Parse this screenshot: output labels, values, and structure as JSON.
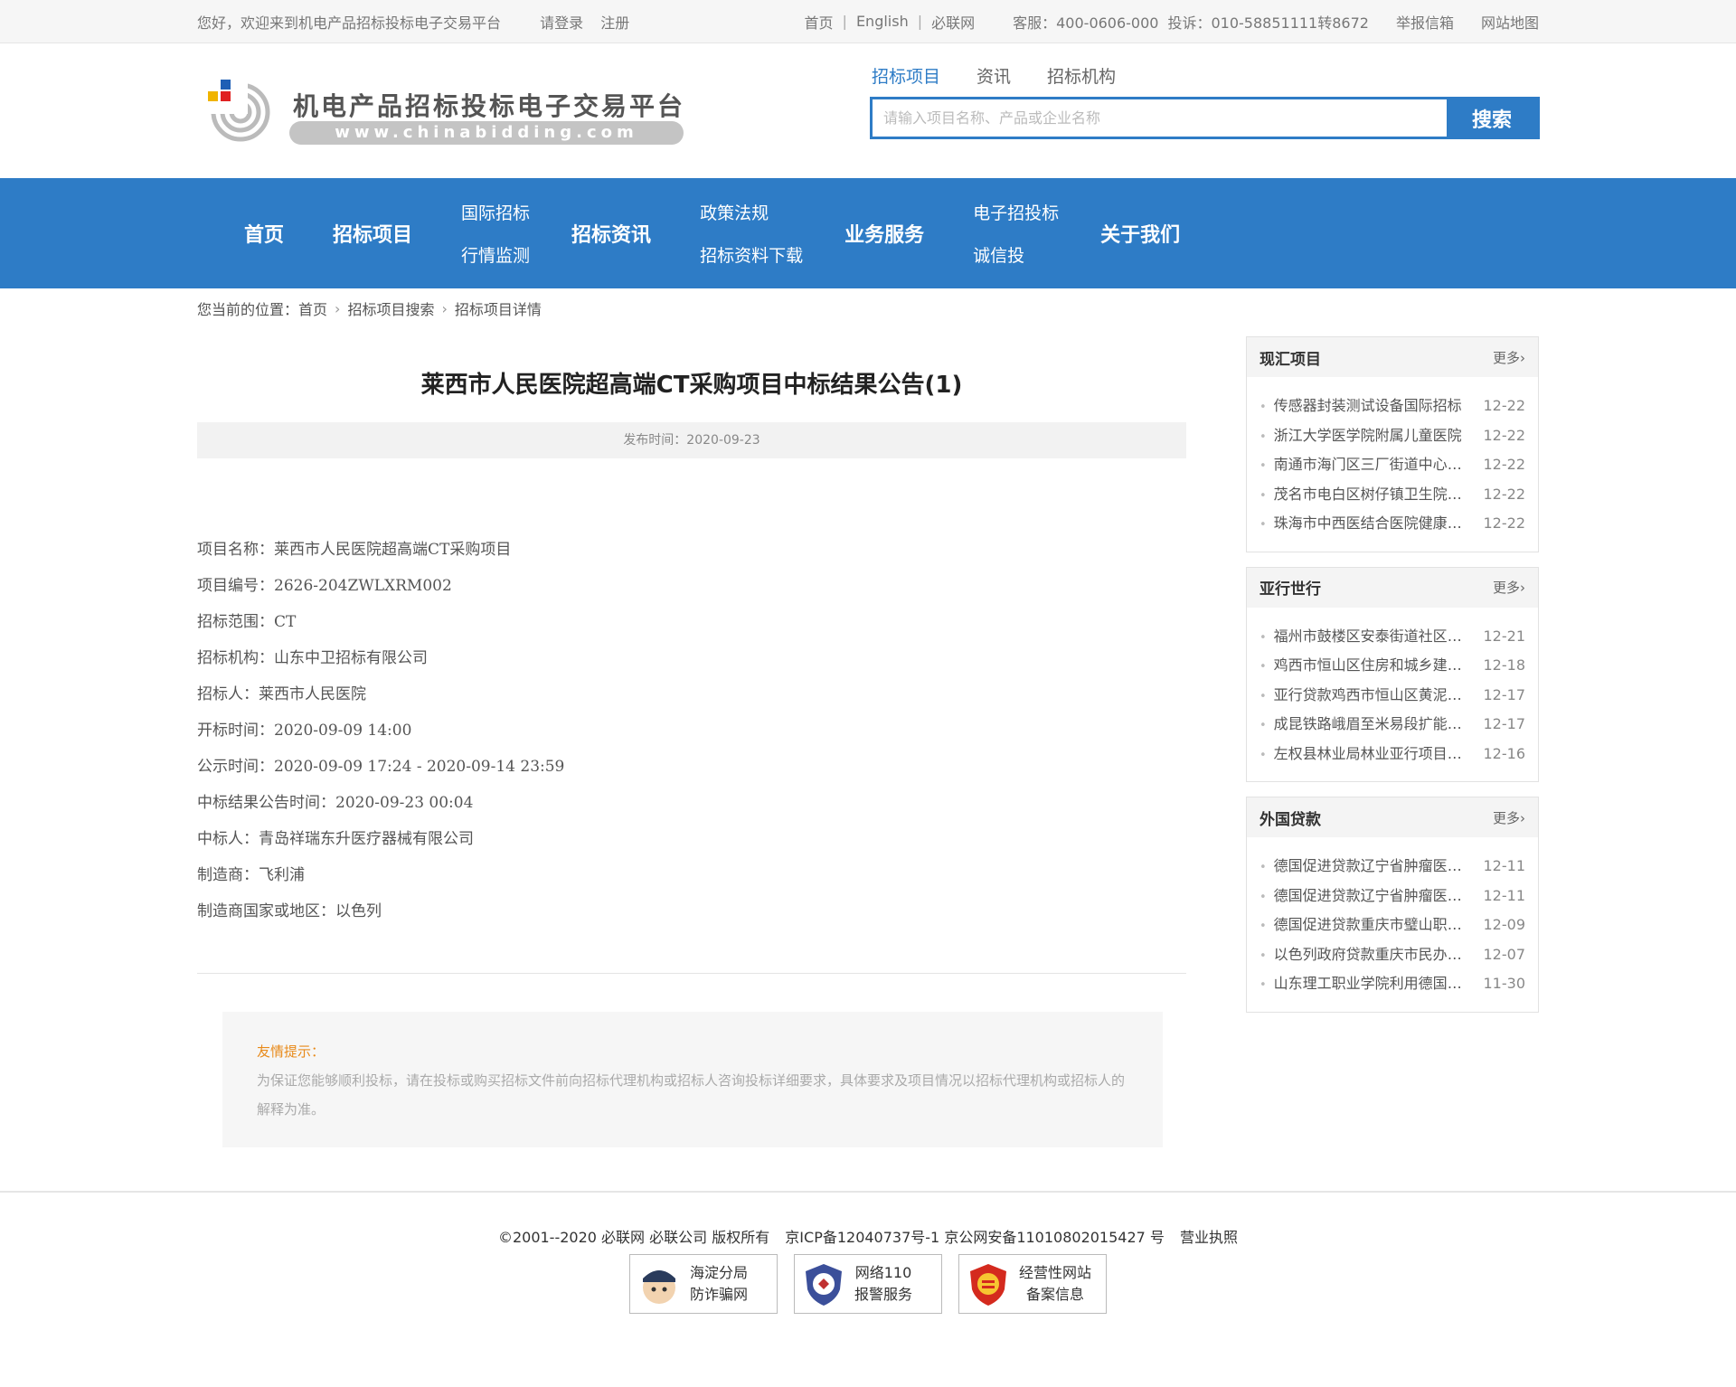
{
  "topbar": {
    "welcome": "您好，欢迎来到机电产品招标投标电子交易平台",
    "login": "请登录",
    "register": "注册",
    "home": "首页",
    "english": "English",
    "bilian": "必联网",
    "service": "客服：400-0606-000",
    "complaint": "投诉：010-58851111转8672",
    "report": "举报信箱",
    "sitemap": "网站地图"
  },
  "logo": {
    "title": "机电产品招标投标电子交易平台",
    "url": "www.chinabidding.com"
  },
  "search": {
    "tabs": [
      "招标项目",
      "资讯",
      "招标机构"
    ],
    "placeholder": "请输入项目名称、产品或企业名称",
    "button": "搜索"
  },
  "nav": {
    "home": "首页",
    "projects": "招标项目",
    "intl_top": "国际招标",
    "intl_bottom": "行情监测",
    "news": "招标资讯",
    "policy_top": "政策法规",
    "policy_bottom": "招标资料下载",
    "business": "业务服务",
    "ebid_top": "电子招投标",
    "ebid_bottom": "诚信投",
    "about": "关于我们"
  },
  "breadcrumb": {
    "prefix": "您当前的位置：",
    "items": [
      "首页",
      "招标项目搜索",
      "招标项目详情"
    ]
  },
  "article": {
    "title": "莱西市人民医院超高端CT采购项目中标结果公告(1)",
    "publish": "发布时间：2020-09-23",
    "details": [
      "项目名称：莱西市人民医院超高端CT采购项目",
      "项目编号：2626-204ZWLXRM002",
      "招标范围：CT",
      "招标机构：山东中卫招标有限公司",
      "招标人：莱西市人民医院",
      "开标时间：2020-09-09 14:00",
      "公示时间：2020-09-09 17:24 - 2020-09-14 23:59",
      "中标结果公告时间：2020-09-23 00:04",
      "中标人：青岛祥瑞东升医疗器械有限公司",
      "制造商：飞利浦",
      "制造商国家或地区：以色列"
    ]
  },
  "notice": {
    "label": "友情提示：",
    "text": "为保证您能够顺利投标，请在投标或购买招标文件前向招标代理机构或招标人咨询投标详细要求，具体要求及项目情况以招标代理机构或招标人的解释为准。"
  },
  "sidebar": {
    "more": "更多",
    "boxes": [
      {
        "title": "现汇项目",
        "items": [
          {
            "t": "传感器封装测试设备国际招标",
            "d": "12-22"
          },
          {
            "t": "浙江大学医学院附属儿童医院",
            "d": "12-22"
          },
          {
            "t": "南通市海门区三厂街道中心卫生院",
            "d": "12-22"
          },
          {
            "t": "茂名市电白区树仔镇卫生院采购",
            "d": "12-22"
          },
          {
            "t": "珠海市中西医结合医院健康管理",
            "d": "12-22"
          }
        ]
      },
      {
        "title": "亚行世行",
        "items": [
          {
            "t": "福州市鼓楼区安泰街道社区改造",
            "d": "12-21"
          },
          {
            "t": "鸡西市恒山区住房和城乡建设局",
            "d": "12-18"
          },
          {
            "t": "亚行贷款鸡西市恒山区黄泥河治理",
            "d": "12-17"
          },
          {
            "t": "成昆铁路峨眉至米易段扩能改造",
            "d": "12-17"
          },
          {
            "t": "左权县林业局林业亚行项目采购",
            "d": "12-16"
          }
        ]
      },
      {
        "title": "外国贷款",
        "items": [
          {
            "t": "德国促进贷款辽宁省肿瘤医院项目",
            "d": "12-11"
          },
          {
            "t": "德国促进贷款辽宁省肿瘤医院设备",
            "d": "12-11"
          },
          {
            "t": "德国促进贷款重庆市璧山职教中心",
            "d": "12-09"
          },
          {
            "t": "以色列政府贷款重庆市民办学校",
            "d": "12-07"
          },
          {
            "t": "山东理工职业学院利用德国贷款",
            "d": "11-30"
          }
        ]
      }
    ]
  },
  "footer": {
    "copyright": "©2001--2020  必联网   必联公司  版权所有",
    "icp": "京ICP备12040737号-1  京公网安备11010802015427 号",
    "license": "营业执照",
    "badges": [
      {
        "line1": "海淀分局",
        "line2": "防诈骗网",
        "icon": "police-icon"
      },
      {
        "line1": "网络110",
        "line2": "报警服务",
        "icon": "shield-110-icon"
      },
      {
        "line1": "经营性网站",
        "line2": "备案信息",
        "icon": "red-seal-icon"
      }
    ]
  }
}
